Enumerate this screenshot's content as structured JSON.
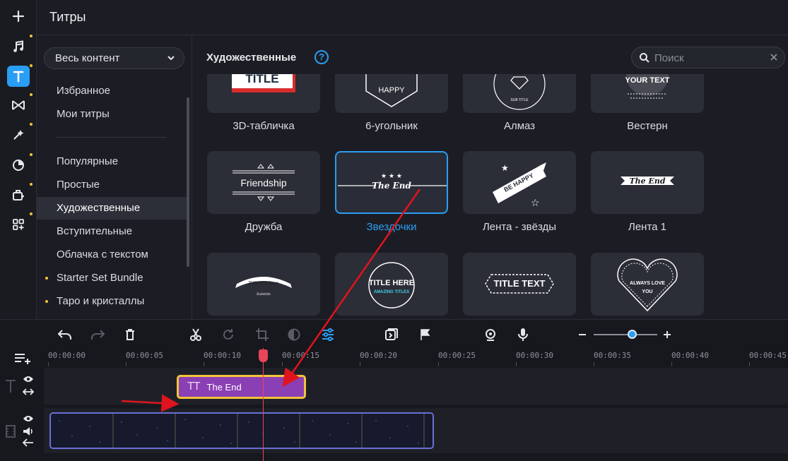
{
  "header": {
    "title": "Титры"
  },
  "rail": {
    "items": [
      {
        "icon": "plus-icon",
        "dot": false
      },
      {
        "icon": "music-icon",
        "dot": true
      },
      {
        "icon": "titles-icon",
        "dot": true,
        "active": true
      },
      {
        "icon": "transitions-icon",
        "dot": true
      },
      {
        "icon": "effects-icon",
        "dot": true
      },
      {
        "icon": "filters-icon",
        "dot": true
      },
      {
        "icon": "stickers-icon",
        "dot": true
      },
      {
        "icon": "more-tools-icon",
        "dot": true
      }
    ]
  },
  "sidebar": {
    "dropdown": "Весь контент",
    "items": [
      {
        "label": "Избранное"
      },
      {
        "label": "Мои титры"
      },
      {
        "label": "Популярные"
      },
      {
        "label": "Простые"
      },
      {
        "label": "Художественные",
        "active": true
      },
      {
        "label": "Вступительные"
      },
      {
        "label": "Облачка с текстом"
      },
      {
        "label": "Starter Set Bundle",
        "bullet": true
      },
      {
        "label": "Таро и кристаллы",
        "bullet": true
      }
    ]
  },
  "content": {
    "section_title": "Художественные",
    "help": "?",
    "search_placeholder": "Поиск",
    "tiles": [
      {
        "label": "3D-табличка",
        "art": "TITLE"
      },
      {
        "label": "6-угольник",
        "art": "HAPPY"
      },
      {
        "label": "Алмаз",
        "art": "SUB TITLE"
      },
      {
        "label": "Вестерн",
        "art": "YOUR TEXT"
      },
      {
        "label": "Дружба",
        "art": "Friendship"
      },
      {
        "label": "Звездочки",
        "art": "The End",
        "selected": true
      },
      {
        "label": "Лента - звёзды",
        "art": "BE HAPPY"
      },
      {
        "label": "Лента 1",
        "art": "The End"
      },
      {
        "label": "",
        "art": "Title text here",
        "art2": "Subtitle"
      },
      {
        "label": "",
        "art": "TITLE HERE",
        "art2": "AMAZING TITLES"
      },
      {
        "label": "",
        "art": "TITLE TEXT"
      },
      {
        "label": "",
        "art": "ALWAYS LOVE",
        "art2": "YOU"
      }
    ]
  },
  "timeline": {
    "ruler": [
      "00:00:00",
      "00:00:05",
      "00:00:10",
      "00:00:15",
      "00:00:20",
      "00:00:25",
      "00:00:30",
      "00:00:35",
      "00:00:40",
      "00:00:45"
    ],
    "title_clip": {
      "icon": "TT",
      "label": "The End"
    },
    "zoom_level": 0.6
  },
  "colors": {
    "accent": "#2a9df4",
    "clip_title": "#8b3fb5",
    "clip_border": "#f3c33b",
    "playhead": "#e8455a",
    "annotation": "#e0141e"
  }
}
